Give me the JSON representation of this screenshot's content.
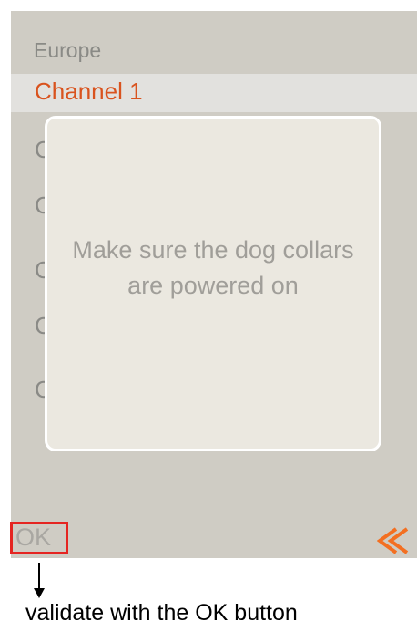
{
  "list": {
    "region": "Europe",
    "selected_channel": "Channel 1",
    "partial_rows": [
      "C",
      "C",
      "C",
      "C",
      "C"
    ]
  },
  "dialog": {
    "message": "Make sure the dog collars are powered on"
  },
  "buttons": {
    "ok_label": "OK",
    "back_icon": "double-chevron-left-icon"
  },
  "annotation": {
    "caption": "validate with the OK button",
    "highlight_color": "#e52521"
  },
  "colors": {
    "accent": "#d9531e",
    "screen_bg": "#cfccc4",
    "modal_bg": "#ebe8e0"
  }
}
